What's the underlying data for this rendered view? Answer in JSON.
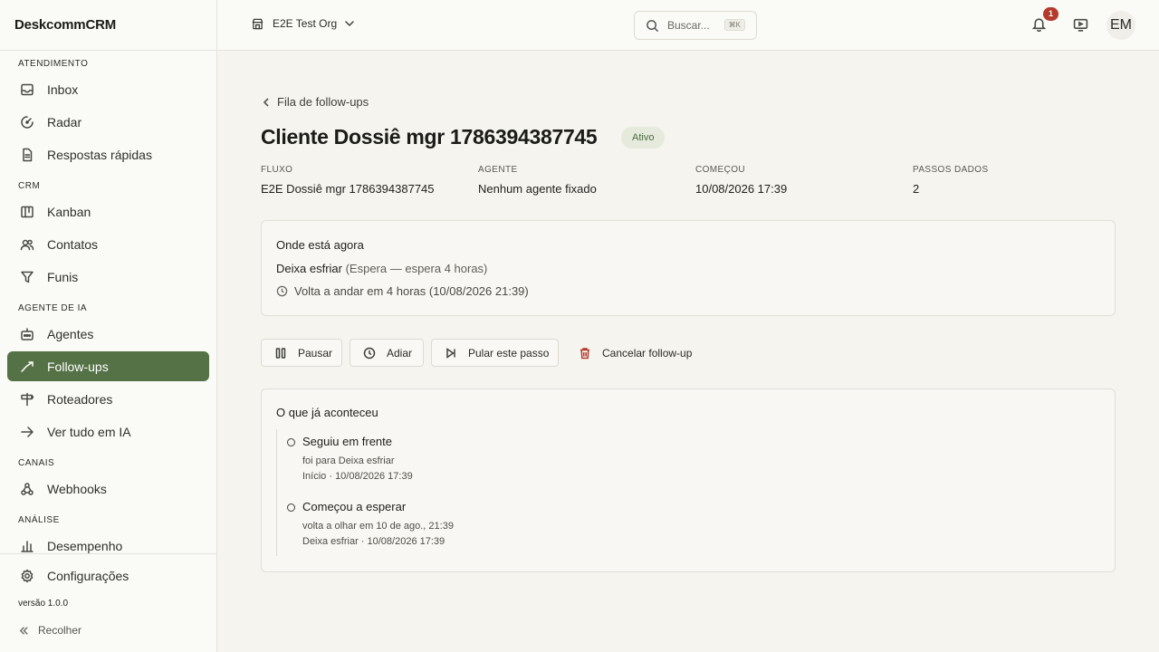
{
  "brand": "DeskcommCRM",
  "sidebar": {
    "sections": {
      "atendimento": "ATENDIMENTO",
      "crm": "CRM",
      "agente_ia": "AGENTE DE IA",
      "canais": "CANAIS",
      "analise": "ANÁLISE"
    },
    "items": {
      "inbox": "Inbox",
      "radar": "Radar",
      "respostas": "Respostas rápidas",
      "kanban": "Kanban",
      "contatos": "Contatos",
      "funis": "Funis",
      "agentes": "Agentes",
      "followups": "Follow-ups",
      "roteadores": "Roteadores",
      "vertudo": "Ver tudo em IA",
      "webhooks": "Webhooks",
      "desempenho": "Desempenho"
    },
    "configuracoes": "Configurações",
    "version": "versão 1.0.0",
    "collapse": "Recolher",
    "active_item": "Follow-ups"
  },
  "header": {
    "org": "E2E Test Org",
    "search_placeholder": "Buscar...",
    "search_shortcut": "⌘K",
    "notifications_count": "1",
    "avatar_initials": "EM"
  },
  "main": {
    "back_label": "Fila de follow-ups",
    "title": "Cliente Dossiê mgr 1786394387745",
    "status": "Ativo",
    "meta": {
      "fluxo_label": "FLUXO",
      "fluxo_value": "E2E Dossiê mgr 1786394387745",
      "agente_label": "AGENTE",
      "agente_value": "Nenhum agente fixado",
      "comecou_label": "COMEÇOU",
      "comecou_value": "10/08/2026 17:39",
      "passos_label": "PASSOS DADOS",
      "passos_value": "2"
    },
    "now": {
      "title": "Onde está agora",
      "step_name": "Deixa esfriar",
      "step_detail": "(Espera — espera 4 horas)",
      "resume": "Volta a andar em 4 horas (10/08/2026 21:39)"
    },
    "actions": {
      "pause": "Pausar",
      "postpone": "Adiar",
      "skip": "Pular este passo",
      "cancel": "Cancelar follow-up"
    },
    "history": {
      "title": "O que já aconteceu",
      "events": [
        {
          "title": "Seguiu em frente",
          "detail": "foi para Deixa esfriar",
          "meta": "Início · 10/08/2026 17:39"
        },
        {
          "title": "Começou a esperar",
          "detail": "volta a olhar em 10 de ago., 21:39",
          "meta": "Deixa esfriar · 10/08/2026 17:39"
        }
      ]
    }
  },
  "colors": {
    "accent": "#557247",
    "status_bg": "#e5eadd",
    "danger": "#b43a2c",
    "background": "#f5f4ef"
  }
}
